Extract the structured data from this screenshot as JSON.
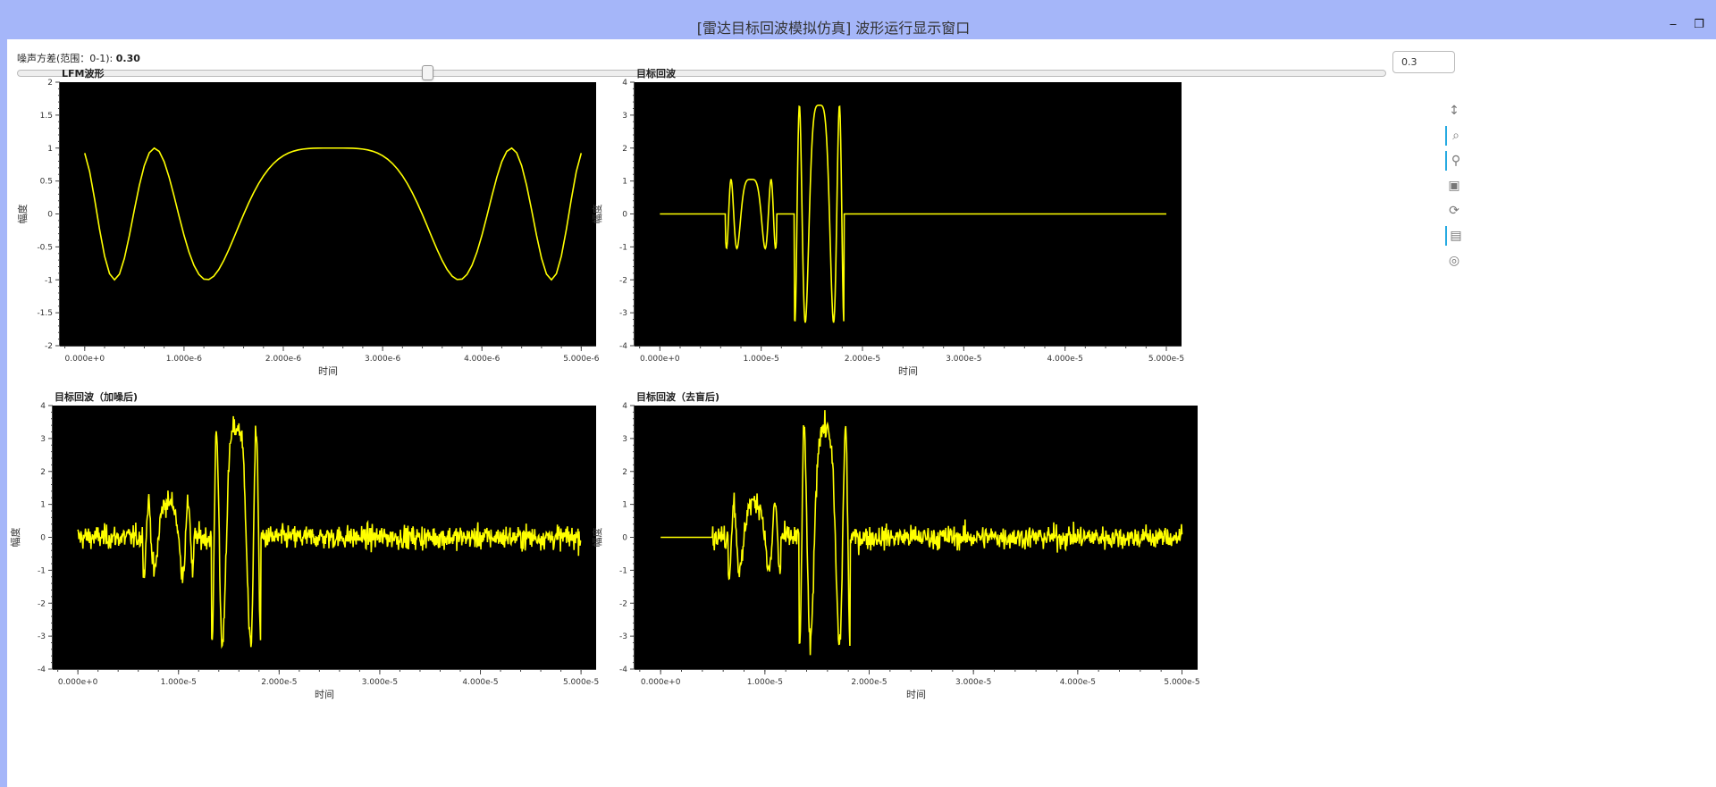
{
  "window": {
    "title": "[雷达目标回波模拟仿真] 波形运行显示窗口",
    "minimize_glyph": "‒",
    "maximize_glyph": "❐"
  },
  "slider": {
    "label": "噪声方差(范围：0-1): ",
    "value_text": "0.30",
    "value": 0.3,
    "min": 0,
    "max": 1,
    "input_value": "0.3"
  },
  "toolbar": {
    "tools": [
      {
        "icon": "pan-vertical-icon",
        "glyph": "↕",
        "active": false
      },
      {
        "icon": "box-zoom-icon",
        "glyph": "⌕",
        "active": true
      },
      {
        "icon": "wheel-zoom-icon",
        "glyph": "⚲",
        "active": true
      },
      {
        "icon": "save-icon",
        "glyph": "▣",
        "active": false
      },
      {
        "icon": "reset-icon",
        "glyph": "⟳",
        "active": false
      },
      {
        "icon": "hover-icon",
        "glyph": "▤",
        "active": true
      },
      {
        "icon": "help-icon",
        "glyph": "◎",
        "active": false
      }
    ]
  },
  "colors": {
    "plot_bg": "#000000",
    "line": "#ffff00",
    "titlebar": "#a5b6f9"
  },
  "chart_data": [
    {
      "type": "line",
      "title": "LFM波形",
      "xlabel": "时间",
      "ylabel": "幅度",
      "xlim": [
        -2.5e-07,
        5.15e-06
      ],
      "ylim": [
        -2,
        2
      ],
      "xticks": [
        "0.000e+0",
        "1.000e-6",
        "2.000e-6",
        "3.000e-6",
        "4.000e-6",
        "5.000e-6"
      ],
      "xtick_values": [
        0,
        1e-06,
        2e-06,
        3e-06,
        4e-06,
        5e-06
      ],
      "yticks": [
        "2",
        "1.5",
        "1",
        "0.5",
        "0",
        "-0.5",
        "-1",
        "-1.5",
        "-2"
      ],
      "ytick_values": [
        2,
        1.5,
        1,
        0.5,
        0,
        -0.5,
        -1,
        -1.5,
        -2
      ],
      "series": [
        {
          "x_range": [
            0,
            5e-06
          ],
          "points": 101,
          "model": "lfm",
          "color": "#ffff00"
        }
      ]
    },
    {
      "type": "line",
      "title": "目标回波",
      "xlabel": "时间",
      "ylabel": "幅度",
      "xlim": [
        -2.5e-06,
        5.15e-05
      ],
      "ylim": [
        -4,
        4
      ],
      "xticks": [
        "0.000e+0",
        "1.000e-5",
        "2.000e-5",
        "3.000e-5",
        "4.000e-5",
        "5.000e-5"
      ],
      "xtick_values": [
        0,
        1e-05,
        2e-05,
        3e-05,
        4e-05,
        5e-05
      ],
      "yticks": [
        "4",
        "3",
        "2",
        "1",
        "0",
        "-1",
        "-2",
        "-3",
        "-4"
      ],
      "ytick_values": [
        4,
        3,
        2,
        1,
        0,
        -1,
        -2,
        -3,
        -4
      ],
      "series": [
        {
          "x_range": [
            0,
            5e-05
          ],
          "points": 1001,
          "model": "echo",
          "noise": 0,
          "color": "#ffff00"
        }
      ]
    },
    {
      "type": "line",
      "title": "目标回波（加噪后)",
      "xlabel": "时间",
      "ylabel": "幅度",
      "xlim": [
        -2.5e-06,
        5.15e-05
      ],
      "ylim": [
        -4,
        4
      ],
      "xticks": [
        "0.000e+0",
        "1.000e-5",
        "2.000e-5",
        "3.000e-5",
        "4.000e-5",
        "5.000e-5"
      ],
      "xtick_values": [
        0,
        1e-05,
        2e-05,
        3e-05,
        4e-05,
        5e-05
      ],
      "yticks": [
        "4",
        "3",
        "2",
        "1",
        "0",
        "-1",
        "-2",
        "-3",
        "-4"
      ],
      "ytick_values": [
        4,
        3,
        2,
        1,
        0,
        -1,
        -2,
        -3,
        -4
      ],
      "series": [
        {
          "x_range": [
            0,
            5e-05
          ],
          "points": 1001,
          "model": "echo",
          "noise": 0.3,
          "color": "#ffff00"
        }
      ]
    },
    {
      "type": "line",
      "title": "目标回波（去盲后)",
      "xlabel": "时间",
      "ylabel": "幅度",
      "xlim": [
        -2.5e-06,
        5.15e-05
      ],
      "ylim": [
        -4,
        4
      ],
      "xticks": [
        "0.000e+0",
        "1.000e-5",
        "2.000e-5",
        "3.000e-5",
        "4.000e-5",
        "5.000e-5"
      ],
      "xtick_values": [
        0,
        1e-05,
        2e-05,
        3e-05,
        4e-05,
        5e-05
      ],
      "yticks": [
        "4",
        "3",
        "2",
        "1",
        "0",
        "-1",
        "-2",
        "-3",
        "-4"
      ],
      "ytick_values": [
        4,
        3,
        2,
        1,
        0,
        -1,
        -2,
        -3,
        -4
      ],
      "series": [
        {
          "x_range": [
            0,
            5e-05
          ],
          "points": 1001,
          "model": "echo",
          "noise": 0.3,
          "blind_until": 5e-06,
          "color": "#ffff00"
        }
      ]
    }
  ]
}
